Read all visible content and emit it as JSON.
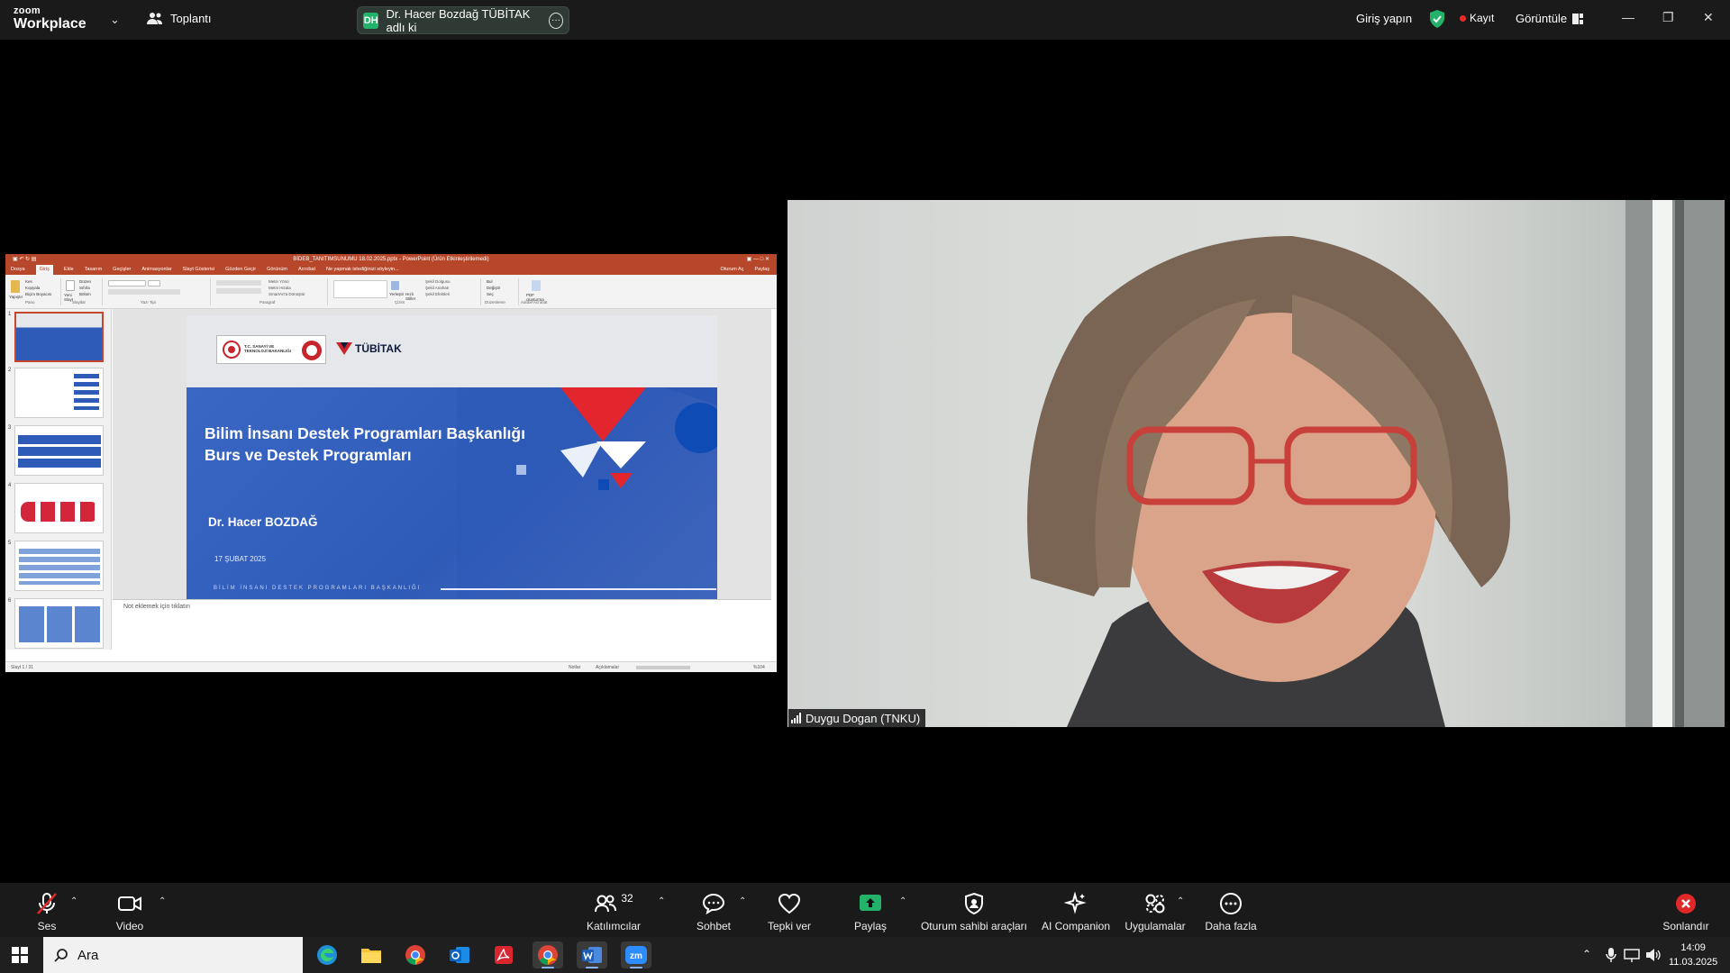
{
  "topbar": {
    "logo_line1": "zoom",
    "logo_line2": "Workplace",
    "meeting_label": "Toplantı",
    "share_initials": "DH",
    "share_label": "Dr. Hacer Bozdağ TÜBİTAK adlı ki",
    "signin_label": "Giriş yapın",
    "record_label": "Kayıt",
    "view_label": "Görüntüle",
    "colors": {
      "bg": "#1a1a1a",
      "shield": "#23b26a",
      "record_dot": "#ea2a2a"
    }
  },
  "ppt": {
    "window_title": "BİDEB_TANITIMSUNUMU 18.02.2025.pptx - PowerPoint (Ürün Etkinleştirilemedi)",
    "tabs": [
      "Dosya",
      "Giriş",
      "Ekle",
      "Tasarım",
      "Geçişler",
      "Animasyonlar",
      "Slayt Gösterisi",
      "Gözden Geçir",
      "Görünüm",
      "Acrobat",
      "Ne yapmak istediğinizi söyleyin..."
    ],
    "active_tab": "Giriş",
    "right_actions": [
      "Oturum Aç",
      "Paylaş"
    ],
    "ribbon_groups": [
      "Pano",
      "Slaytlar",
      "Yazı Tipi",
      "Paragraf",
      "Çizim",
      "Düzenleme",
      "Adobe Acrobat"
    ],
    "ribbon_items": {
      "paste": "Yapıştır",
      "cut": "Kes",
      "copy": "Kopyala",
      "format_painter": "Biçim Boyacısı",
      "new_slide": "Yeni Slayt",
      "layout": "Düzen",
      "reset": "Sıfırla",
      "section": "Bölüm",
      "text_direction": "Metin Yönü",
      "align_text": "Metni Hizala",
      "smartart": "SmartArt'a Dönüştür",
      "arrange": "Yerleştir",
      "quick_styles": "Hızlı Stiller",
      "shape_fill": "Şekil Dolgusu",
      "shape_outline": "Şekil Anahatı",
      "shape_effects": "Şekil Efektleri",
      "find": "Bul",
      "replace": "Değiştir",
      "select": "Seç",
      "create_pdf": "PDF oluşturma"
    },
    "thumb_numbers": [
      "1",
      "2",
      "3",
      "4",
      "5",
      "6"
    ],
    "notes_placeholder": "Not eklemek için tıklatın",
    "status_left": "Slayt 1 / 31",
    "status_notes": "Notlar",
    "status_comments": "Açıklamalar",
    "zoom": "%104",
    "colors": {
      "accent": "#b7472a",
      "ribbon": "#f3f3f3"
    }
  },
  "slide": {
    "logo_text_1": "T.C. SANAYİ VE",
    "logo_text_2": "TEKNOLOJİ BAKANLIĞI",
    "brand": "TÜBİTAK",
    "title_line1": "Bilim İnsanı Destek Programları Başkanlığı",
    "title_line2": "Burs ve Destek Programları",
    "author": "Dr. Hacer BOZDAĞ",
    "date": "17 ŞUBAT 2025",
    "footer": "BİLİM İNSANI DESTEK PROGRAMLARI BAŞKANLIĞI",
    "colors": {
      "blue": "#2f5bb8",
      "red": "#e3262d",
      "header": "#e6e7ea",
      "dark_blue": "#0e4bb5"
    }
  },
  "video": {
    "participant_name": "Duygu Dogan (TNKU)"
  },
  "toolbar": {
    "audio_label": "Ses",
    "video_label": "Video",
    "participants_label": "Katılımcılar",
    "participants_count": "32",
    "chat_label": "Sohbet",
    "react_label": "Tepki ver",
    "share_label": "Paylaş",
    "host_tools_label": "Oturum sahibi araçları",
    "ai_label": "AI Companion",
    "apps_label": "Uygulamalar",
    "more_label": "Daha fazla",
    "end_label": "Sonlandır",
    "colors": {
      "share": "#23b26a",
      "end": "#e02828",
      "audio_muted": "#e02828"
    }
  },
  "taskbar": {
    "search_placeholder": "Ara",
    "apps": [
      "edge-icon",
      "file-explorer-icon",
      "chrome-icon",
      "outlook-icon",
      "acrobat-icon",
      "chrome-profile-icon",
      "word-icon",
      "zoom-icon"
    ],
    "time": "14:09",
    "date": "11.03.2025"
  }
}
